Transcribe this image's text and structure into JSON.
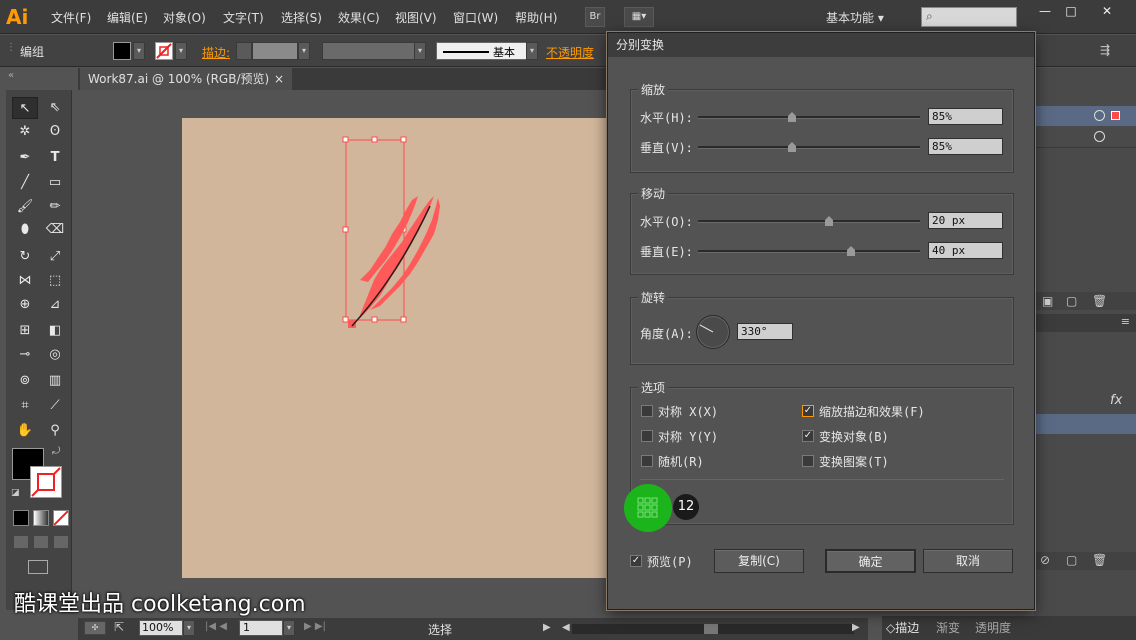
{
  "app": {
    "logo": "Ai",
    "menu": [
      "文件(F)",
      "编辑(E)",
      "对象(O)",
      "文字(T)",
      "选择(S)",
      "效果(C)",
      "视图(V)",
      "窗口(W)",
      "帮助(H)"
    ],
    "bridge_label": "Br",
    "workspace": "基本功能",
    "search_placeholder": ""
  },
  "control_bar": {
    "selection": "编组",
    "stroke_label": "描边:",
    "stroke_style": "基本",
    "opacity_label": "不透明度"
  },
  "document_tab": {
    "title": "Work87.ai @ 100% (RGB/预览)",
    "close": "×"
  },
  "status_bar": {
    "zoom": "100%",
    "page": "1",
    "tool": "选择"
  },
  "dialog": {
    "title": "分别变换",
    "scale": {
      "title": "缩放",
      "horizontal_label": "水平(H):",
      "horizontal_value": "85%",
      "horizontal_level": 85,
      "vertical_label": "垂直(V):",
      "vertical_value": "85%",
      "vertical_level": 85
    },
    "move": {
      "title": "移动",
      "horizontal_label": "水平(O):",
      "horizontal_value": "20 px",
      "vertical_label": "垂直(E):",
      "vertical_value": "40 px"
    },
    "rotate": {
      "title": "旋转",
      "angle_label": "角度(A):",
      "angle_value": "330°"
    },
    "options": {
      "title": "选项",
      "reflect_x": {
        "label": "对称 X(X)",
        "checked": false
      },
      "reflect_y": {
        "label": "对称 Y(Y)",
        "checked": false
      },
      "random": {
        "label": "随机(R)",
        "checked": false
      },
      "scale_strokes": {
        "label": "缩放描边和效果(F)",
        "checked": true
      },
      "transform_objects": {
        "label": "变换对象(B)",
        "checked": true
      },
      "transform_patterns": {
        "label": "变换图案(T)",
        "checked": false
      }
    },
    "preview": {
      "label": "预览(P)",
      "checked": true
    },
    "copy_button": "复制(C)",
    "ok_button": "确定",
    "cancel_button": "取消"
  },
  "tutorial": {
    "step_number": "12",
    "watermark": "酷课堂出品 coolketang.com"
  },
  "right_panel": {
    "tabs": [
      "描边",
      "渐变",
      "透明度"
    ],
    "fx_label": "fx"
  },
  "colors": {
    "accent_orange": "#ff9a00",
    "artboard": "#d2b69c",
    "artwork_red": "#ff5a5a",
    "step_green": "#1bb51b"
  }
}
